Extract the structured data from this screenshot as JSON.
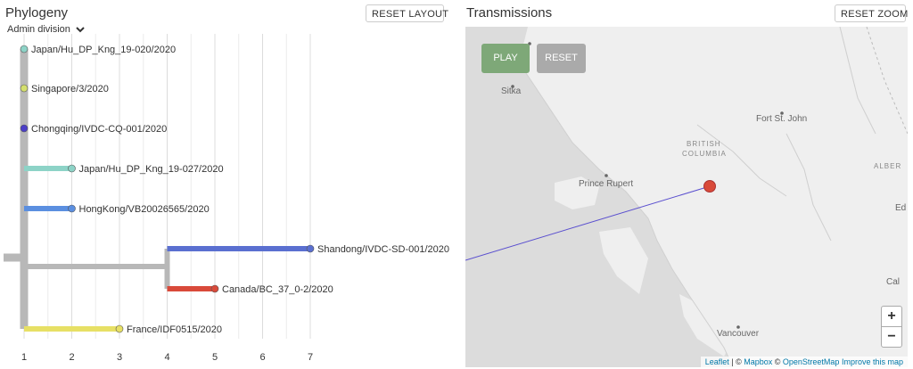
{
  "phylogeny": {
    "title": "Phylogeny",
    "reset_layout_label": "RESET LAYOUT",
    "color_by_label": "Admin division",
    "axis_ticks": [
      "1",
      "2",
      "3",
      "4",
      "5",
      "6",
      "7"
    ],
    "tips": [
      {
        "name": "Japan/Hu_DP_Kng_19-020/2020",
        "divergence": 1,
        "color": "#8dd3c7"
      },
      {
        "name": "Singapore/3/2020",
        "divergence": 1,
        "color": "#d4df6e"
      },
      {
        "name": "Chongqing/IVDC-CQ-001/2020",
        "divergence": 1,
        "color": "#4b3ec7"
      },
      {
        "name": "Japan/Hu_DP_Kng_19-027/2020",
        "divergence": 2,
        "color": "#8dd3c7"
      },
      {
        "name": "HongKong/VB20026565/2020",
        "divergence": 2,
        "color": "#5b8fe0"
      },
      {
        "name": "Shandong/IVDC-SD-001/2020",
        "divergence": 7,
        "color": "#5a6fd0"
      },
      {
        "name": "Canada/BC_37_0-2/2020",
        "divergence": 5,
        "color": "#d94a3a"
      },
      {
        "name": "France/IDF0515/2020",
        "divergence": 3,
        "color": "#e7e065"
      }
    ],
    "internal_node_divergence": 4
  },
  "transmissions": {
    "title": "Transmissions",
    "reset_zoom_label": "RESET ZOOM",
    "play_label": "PLAY",
    "reset_label": "RESET",
    "zoom_in_label": "+",
    "zoom_out_label": "−",
    "places": {
      "sitka": "Sitka",
      "fort_st_john": "Fort St. John",
      "prince_rupert": "Prince Rupert",
      "vancouver": "Vancouver",
      "british": "BRITISH",
      "columbia": "COLUMBIA",
      "alberta": "ALBER",
      "cal": "Cal",
      "ed": "Ed"
    },
    "attribution": {
      "leaflet": "Leaflet",
      "sep1": " | © ",
      "mapbox": "Mapbox",
      "sep2": " © ",
      "osm": "OpenStreetMap",
      "improve": "Improve this map"
    },
    "transmission_color": "#5a4fcf",
    "marker_color": "#d94a3a"
  }
}
